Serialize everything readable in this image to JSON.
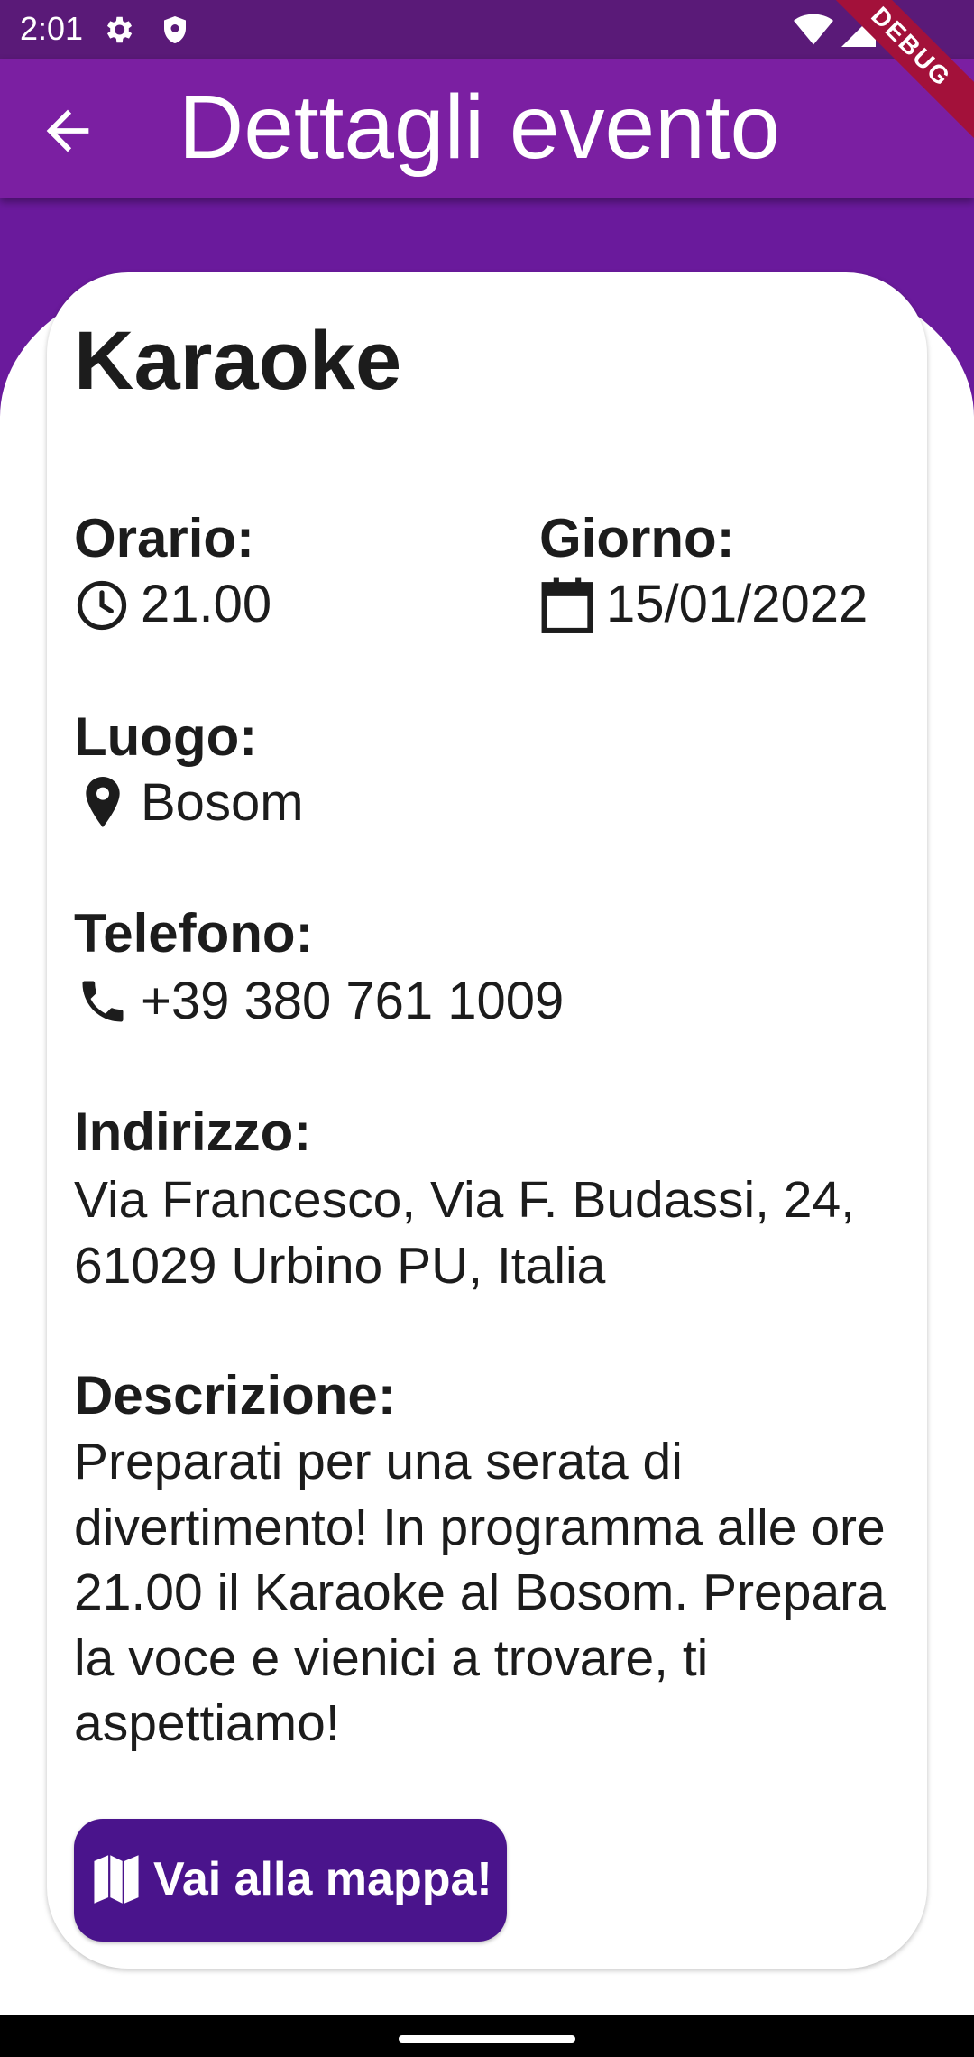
{
  "status_bar": {
    "time": "2:01",
    "icons": [
      "gear-icon",
      "shield-icon",
      "wifi-icon",
      "signal-icon",
      "battery-icon"
    ]
  },
  "app_bar": {
    "title": "Dettagli evento",
    "back_icon": "arrow-back-icon",
    "debug_banner": "DEBUG"
  },
  "event": {
    "title": "Karaoke",
    "time": {
      "label": "Orario:",
      "value": "21.00",
      "icon": "clock-icon"
    },
    "day": {
      "label": "Giorno:",
      "value": "15/01/2022",
      "icon": "calendar-icon"
    },
    "place": {
      "label": "Luogo:",
      "value": "Bosom",
      "icon": "location-pin-icon"
    },
    "phone": {
      "label": "Telefono:",
      "value": "+39 380 761 1009",
      "icon": "phone-icon"
    },
    "address": {
      "label": "Indirizzo:",
      "value": "Via Francesco, Via F. Budassi, 24, 61029 Urbino PU, Italia"
    },
    "description": {
      "label": "Descrizione:",
      "value": "Preparati per una serata di divertimento! In programma alle ore 21.00 il Karaoke al Bosom. Prepara la voce e vienici a trovare, ti aspettiamo!"
    }
  },
  "map_button": {
    "label": "Vai alla mappa!",
    "icon": "map-icon"
  },
  "colors": {
    "status_bar": "#5a1a78",
    "app_bar": "#7b1fa2",
    "header_bg": "#6a1a9c",
    "button": "#4a148c",
    "debug_banner": "#a3113a"
  }
}
